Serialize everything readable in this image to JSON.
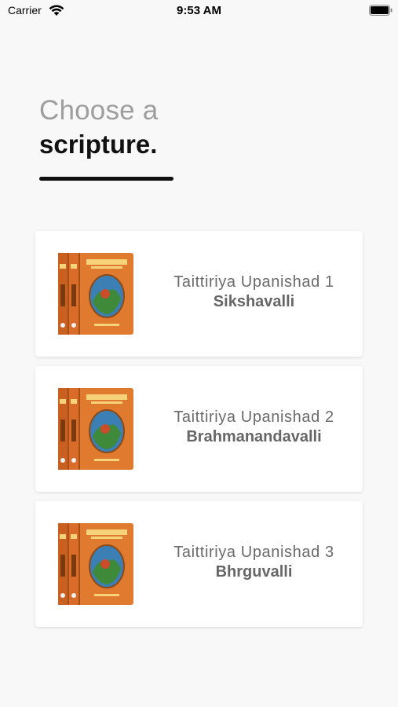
{
  "status_bar": {
    "carrier": "Carrier",
    "time": "9:53 AM"
  },
  "heading": {
    "line1": "Choose a",
    "line2": "scripture."
  },
  "colors": {
    "background": "#f8f8f8",
    "card": "#ffffff",
    "book_cover": "#e07a2f",
    "text_muted": "#6a6a6a"
  },
  "scriptures": [
    {
      "title": "Taittiriya Upanishad 1",
      "subtitle": "Sikshavalli",
      "icon": "book-cover-icon"
    },
    {
      "title": "Taittiriya Upanishad 2",
      "subtitle": "Brahmanandavalli",
      "icon": "book-cover-icon"
    },
    {
      "title": "Taittiriya Upanishad 3",
      "subtitle": "Bhrguvalli",
      "icon": "book-cover-icon"
    }
  ]
}
